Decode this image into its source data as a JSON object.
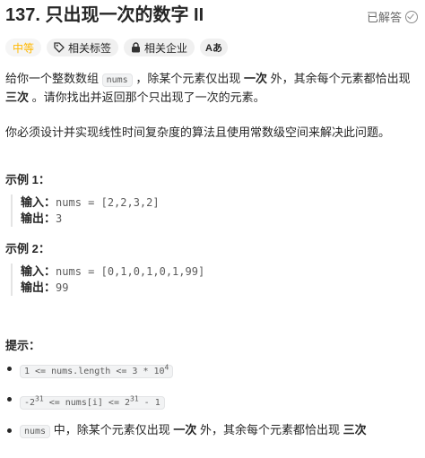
{
  "problem": {
    "title": "137. 只出现一次的数字 II",
    "solved_label": "已解答"
  },
  "tags": {
    "difficulty": "中等",
    "topics": "相关标签",
    "companies": "相关企业",
    "font": "Aあ"
  },
  "description": {
    "p1_part1": "给你一个整数数组 ",
    "p1_code": "nums",
    "p1_part2": " ，除某个元素仅出现 ",
    "p1_bold1": "一次",
    "p1_part3": " 外，其余每个元素都恰出现 ",
    "p1_bold2": "三次",
    "p1_part4": " 。请你找出并返回那个只出现了一次的元素。",
    "p2": "你必须设计并实现线性时间复杂度的算法且使用常数级空间来解决此问题。"
  },
  "examples": [
    {
      "heading": "示例 1：",
      "input_label": "输入：",
      "input_value": "nums = [2,2,3,2]",
      "output_label": "输出：",
      "output_value": "3"
    },
    {
      "heading": "示例 2：",
      "input_label": "输入：",
      "input_value": "nums = [0,1,0,1,0,1,99]",
      "output_label": "输出：",
      "output_value": "99"
    }
  ],
  "constraints": {
    "heading": "提示：",
    "c1_code": "1 <= nums.length <= 3 * 10",
    "c1_sup": "4",
    "c2_part1": "-2",
    "c2_sup1": "31",
    "c2_part2": " <= nums[i] <= 2",
    "c2_sup2": "31",
    "c2_part3": " - 1",
    "c3_code": "nums",
    "c3_part1": " 中，除某个元素仅出现 ",
    "c3_bold1": "一次",
    "c3_part2": " 外，其余每个元素都恰出现 ",
    "c3_bold2": "三次"
  },
  "colors": {
    "difficulty_medium": "#ffb800",
    "text": "#262626",
    "code_bg": "#f2f3f4"
  },
  "icons": {
    "solved": "check-circle-icon",
    "tag": "tag-icon",
    "lock": "lock-icon"
  }
}
